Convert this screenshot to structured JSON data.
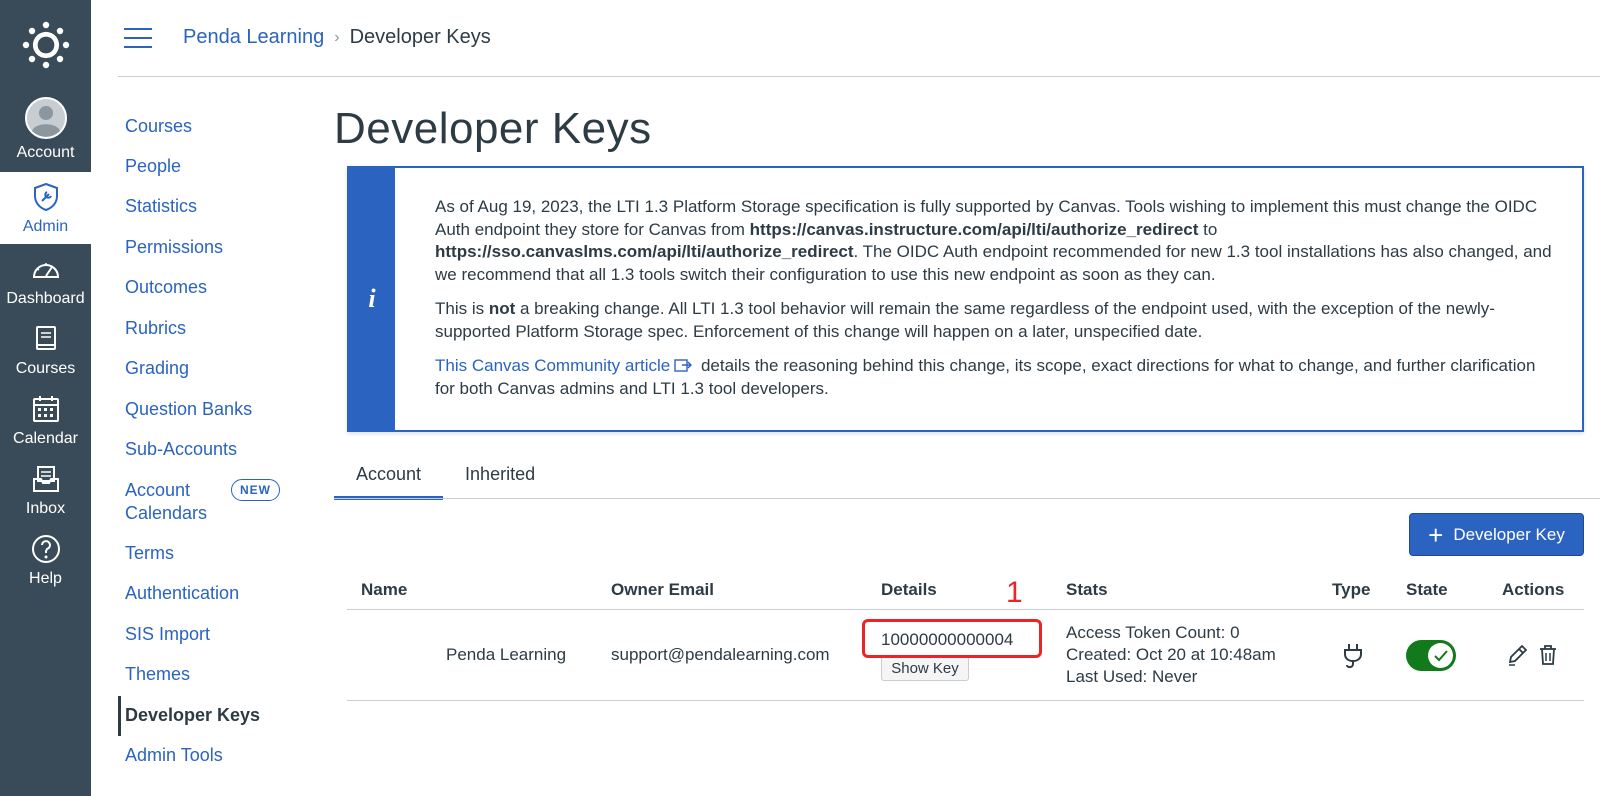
{
  "global_nav": {
    "logo_icon": "canvas-logo-icon",
    "items": [
      {
        "label": "Account",
        "icon": "account-avatar-icon",
        "active": false
      },
      {
        "label": "Admin",
        "icon": "admin-shield-icon",
        "active": true
      },
      {
        "label": "Dashboard",
        "icon": "dashboard-gauge-icon",
        "active": false
      },
      {
        "label": "Courses",
        "icon": "courses-book-icon",
        "active": false
      },
      {
        "label": "Calendar",
        "icon": "calendar-icon",
        "active": false
      },
      {
        "label": "Inbox",
        "icon": "inbox-icon",
        "active": false
      },
      {
        "label": "Help",
        "icon": "help-icon",
        "active": false
      }
    ],
    "bg_color": "#394b58",
    "active_color": "#2b63c0"
  },
  "header": {
    "breadcrumb": {
      "parent": "Penda Learning",
      "separator": "›",
      "current": "Developer Keys"
    }
  },
  "side_nav": {
    "items": [
      {
        "label": "Courses"
      },
      {
        "label": "People"
      },
      {
        "label": "Statistics"
      },
      {
        "label": "Permissions"
      },
      {
        "label": "Outcomes"
      },
      {
        "label": "Rubrics"
      },
      {
        "label": "Grading"
      },
      {
        "label": "Question Banks"
      },
      {
        "label": "Sub-Accounts"
      },
      {
        "label": "Account Calendars",
        "label_line1": "Account",
        "label_line2": "Calendars",
        "badge": "NEW"
      },
      {
        "label": "Terms"
      },
      {
        "label": "Authentication"
      },
      {
        "label": "SIS Import"
      },
      {
        "label": "Themes"
      },
      {
        "label": "Developer Keys",
        "active": true
      },
      {
        "label": "Admin Tools"
      }
    ]
  },
  "main": {
    "title": "Developer Keys",
    "alert": {
      "icon": "info-icon",
      "p1_a": "As of Aug 19, 2023, the LTI 1.3 Platform Storage specification is fully supported by Canvas. Tools wishing to implement this must change the OIDC Auth endpoint they store for Canvas from ",
      "p1_url1": "https://canvas.instructure.com/api/lti/authorize_redirect",
      "p1_b": " to ",
      "p1_url2": "https://sso.canvaslms.com/api/lti/authorize_redirect",
      "p1_c": ". The OIDC Auth endpoint recommended for new 1.3 tool installations has also changed, and we recommend that all 1.3 tools switch their configuration to use this new endpoint as soon as they can.",
      "p2_a": "This is ",
      "p2_bold": "not",
      "p2_b": " a breaking change. All LTI 1.3 tool behavior will remain the same regardless of the endpoint used, with the exception of the newly-supported Platform Storage spec. Enforcement of this change will happen on a later, unspecified date.",
      "p3_link": "This Canvas Community article",
      "p3_rest": " details the reasoning behind this change, its scope, exact directions for what to change, and further clarification for both Canvas admins and LTI 1.3 tool developers."
    },
    "tabs": [
      {
        "label": "Account",
        "active": true
      },
      {
        "label": "Inherited",
        "active": false
      }
    ],
    "add_button": {
      "label": "Developer Key",
      "icon": "plus-icon"
    },
    "table": {
      "headers": [
        "Name",
        "Owner Email",
        "Details",
        "Stats",
        "Type",
        "State",
        "Actions"
      ],
      "rows": [
        {
          "name": "Penda Learning",
          "email": "support@pendalearning.com",
          "key_id": "10000000000004",
          "show_key_label": "Show Key",
          "stats": [
            "Access Token Count: 0",
            "Created: Oct 20 at 10:48am",
            "Last Used: Never"
          ],
          "type_icon": "lti-plug-icon",
          "state": "on",
          "actions": [
            "edit-pencil-icon",
            "delete-trash-icon"
          ]
        }
      ]
    },
    "annotation": {
      "number": "1",
      "color": "#e8262a"
    }
  }
}
